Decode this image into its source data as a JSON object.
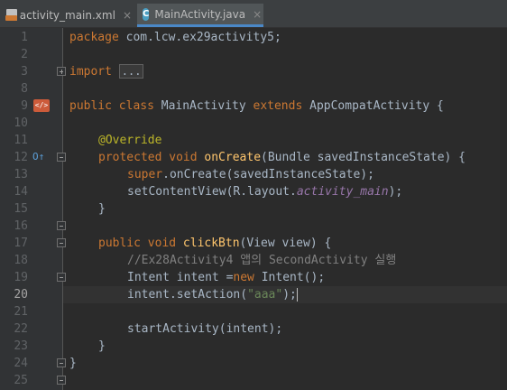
{
  "tabs": [
    {
      "label": "activity_main.xml",
      "active": false,
      "icon": "xml-file-icon"
    },
    {
      "label": "MainActivity.java",
      "active": true,
      "icon": "java-class-icon",
      "icon_letter": "C"
    }
  ],
  "tab_close_glyph": "×",
  "current_line": "20",
  "line_numbers": [
    "1",
    "2",
    "3",
    "8",
    "9",
    "10",
    "11",
    "12",
    "13",
    "14",
    "15",
    "16",
    "17",
    "18",
    "19",
    "20",
    "21",
    "22",
    "23",
    "24",
    "25"
  ],
  "code": {
    "l1": {
      "kw": "package",
      "rest": " com.lcw.ex29activity5;"
    },
    "l3": {
      "kw": "import",
      "folded": "..."
    },
    "l9": {
      "kw1": "public class",
      "name": " MainActivity ",
      "kw2": "extends",
      "rest": " AppCompatActivity {"
    },
    "l11": {
      "annotation": "@Override"
    },
    "l12": {
      "kw": "protected void",
      "fn": "onCreate",
      "rest": "(Bundle savedInstanceState) {"
    },
    "l13": {
      "kw": "super",
      "rest": ".onCreate(savedInstanceState);"
    },
    "l14": {
      "call": "setContentView(R.layout.",
      "field": "activity_main",
      "end": ");"
    },
    "l15": {
      "text": "}"
    },
    "l17": {
      "kw": "public void",
      "fn": "clickBtn",
      "rest": "(View view) {"
    },
    "l18": {
      "comment": "//Ex28Activity4 앱의 SecondActivity 실행"
    },
    "l19": {
      "text": "Intent intent =",
      "kw": "new",
      "rest": " Intent();"
    },
    "l20": {
      "text": "intent.setAction(",
      "str": "\"aaa\"",
      "end": ");"
    },
    "l22": {
      "text": "startActivity(intent);"
    },
    "l23": {
      "text": "}"
    },
    "l24": {
      "text": "}"
    }
  },
  "colors": {
    "background": "#2b2b2b",
    "keyword": "#cc7832",
    "method": "#ffc66d",
    "annotation": "#bbb529",
    "comment": "#808080",
    "string": "#6a8759",
    "field": "#9876aa",
    "text": "#a9b7c6"
  }
}
